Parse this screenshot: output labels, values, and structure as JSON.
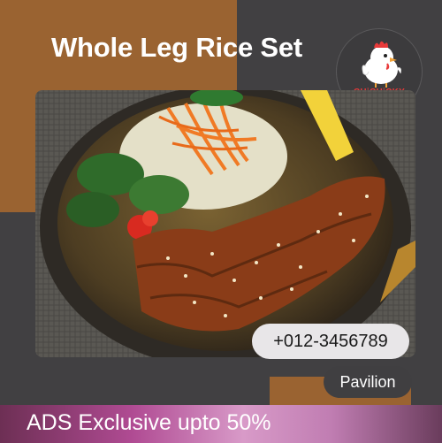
{
  "ad": {
    "title": "Whole Leg Rice Set",
    "brand_logo_text": "CHiCHiCKY",
    "phone": "+012-3456789",
    "location": "Pavilion",
    "promo": "ADS Exclusive upto 50%"
  },
  "colors": {
    "background": "#414042",
    "accent_brown": "#9a6331",
    "logo_red": "#e83a3a",
    "phone_pill": "#e8e6e8",
    "banner_pink": "#b04b93"
  },
  "icons": [
    "chicken-mascot-icon"
  ]
}
